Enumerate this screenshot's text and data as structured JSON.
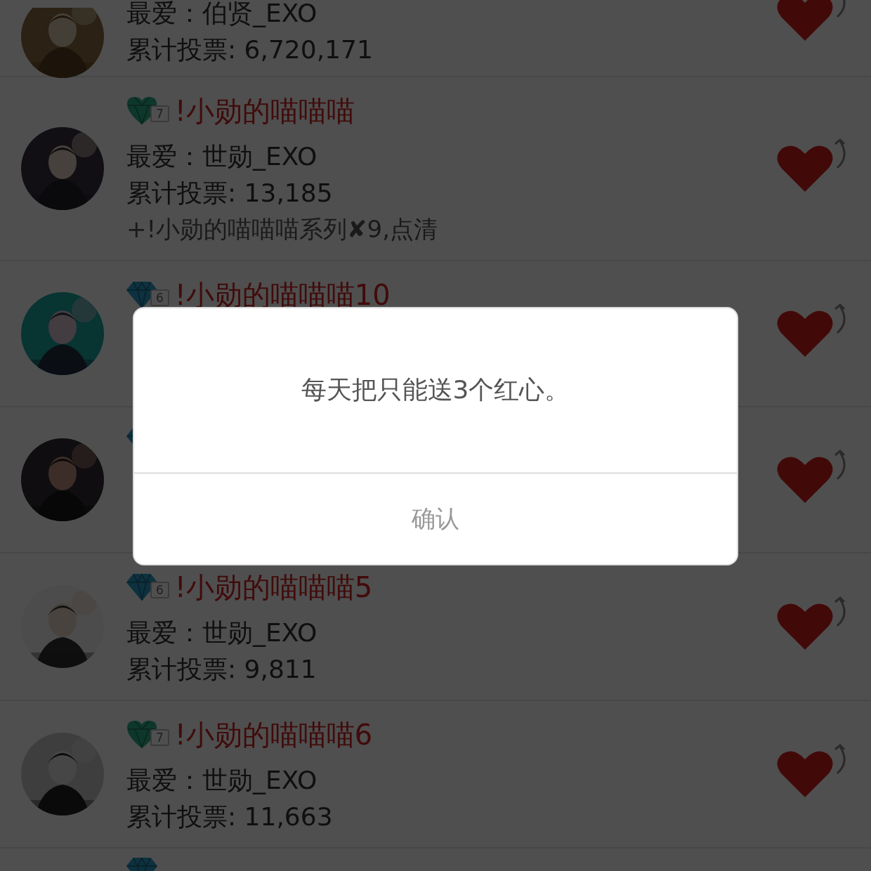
{
  "rows": [
    {
      "favorite": "最爱：伯贤_EXO",
      "votes": "累计投票: 6,720,171"
    },
    {
      "badge": {
        "kind": "heart",
        "level": "7"
      },
      "title": "!小勋的喵喵喵",
      "favorite": "最爱：世勋_EXO",
      "votes": "累计投票: 13,185",
      "note": "+!小勋的喵喵喵系列✘9,点清"
    },
    {
      "badge": {
        "kind": "diamond",
        "level": "6"
      },
      "title": "!小勋的喵喵喵10"
    },
    {
      "badge": {
        "kind": "diamond"
      }
    },
    {
      "badge": {
        "kind": "diamond",
        "level": "6"
      },
      "title": "!小勋的喵喵喵5",
      "favorite": "最爱：世勋_EXO",
      "votes": "累计投票: 9,811"
    },
    {
      "badge": {
        "kind": "heart",
        "level": "7"
      },
      "title": "!小勋的喵喵喵6",
      "favorite": "最爱：世勋_EXO",
      "votes": "累计投票: 11,663"
    },
    {
      "badge": {
        "kind": "diamond"
      }
    }
  ],
  "dialog": {
    "message": "每天把只能送3个红心。",
    "button": "确认"
  }
}
